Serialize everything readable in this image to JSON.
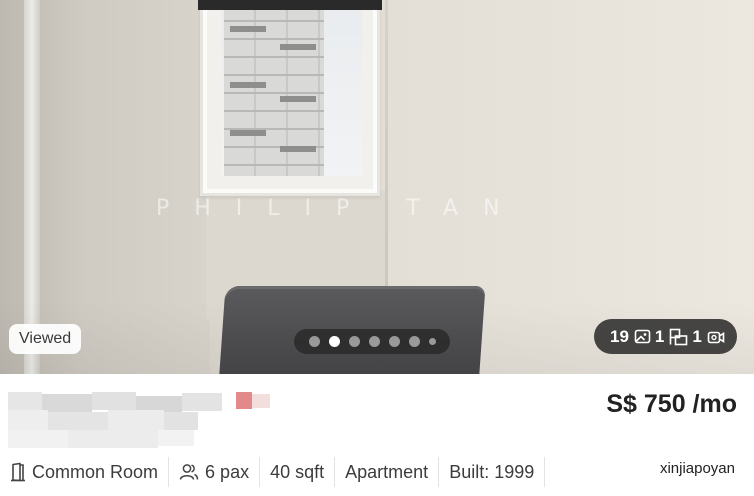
{
  "photo": {
    "watermark": "PHILIP TAN",
    "viewed_badge": "Viewed",
    "carousel": {
      "total_dots": 7,
      "active_index": 1
    },
    "media_counts": {
      "photos": "19",
      "floorplans": "1",
      "videos": "1"
    }
  },
  "listing": {
    "price": "S$ 750 /mo",
    "specs": {
      "room_type": "Common Room",
      "pax": "6 pax",
      "size": "40 sqft",
      "property_type": "Apartment",
      "built": "Built: 1999"
    },
    "agent_name": "xinjiapoyan"
  },
  "icons": [
    "door-icon",
    "people-icon",
    "photo-icon",
    "floorplan-icon",
    "video-icon"
  ]
}
